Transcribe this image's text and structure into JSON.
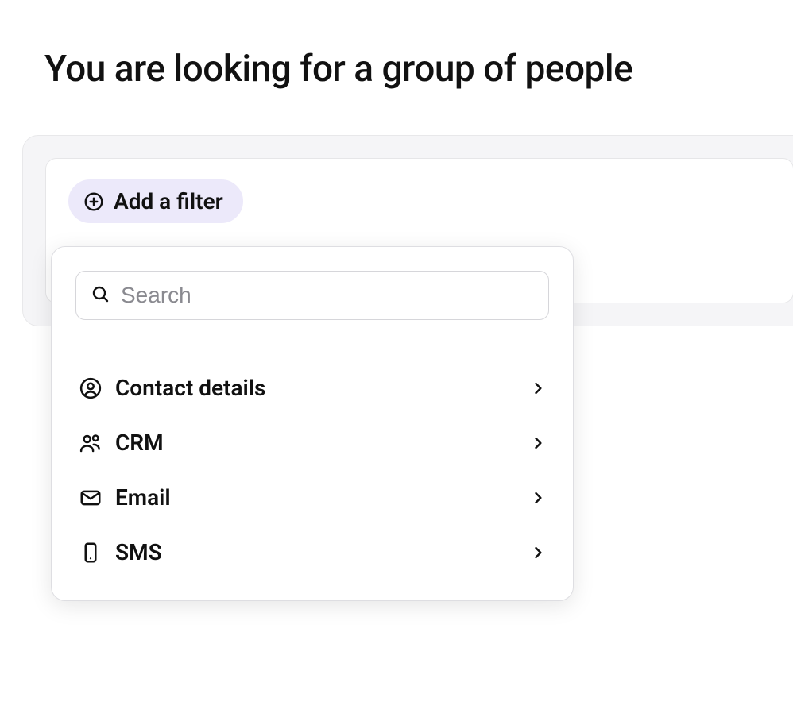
{
  "page": {
    "title": "You are looking for a group of people"
  },
  "filter": {
    "add_label": "Add a filter"
  },
  "dropdown": {
    "search_placeholder": "Search",
    "items": [
      {
        "icon": "user-circle-icon",
        "label": "Contact details"
      },
      {
        "icon": "people-icon",
        "label": "CRM"
      },
      {
        "icon": "envelope-icon",
        "label": "Email"
      },
      {
        "icon": "phone-icon",
        "label": "SMS"
      }
    ]
  }
}
